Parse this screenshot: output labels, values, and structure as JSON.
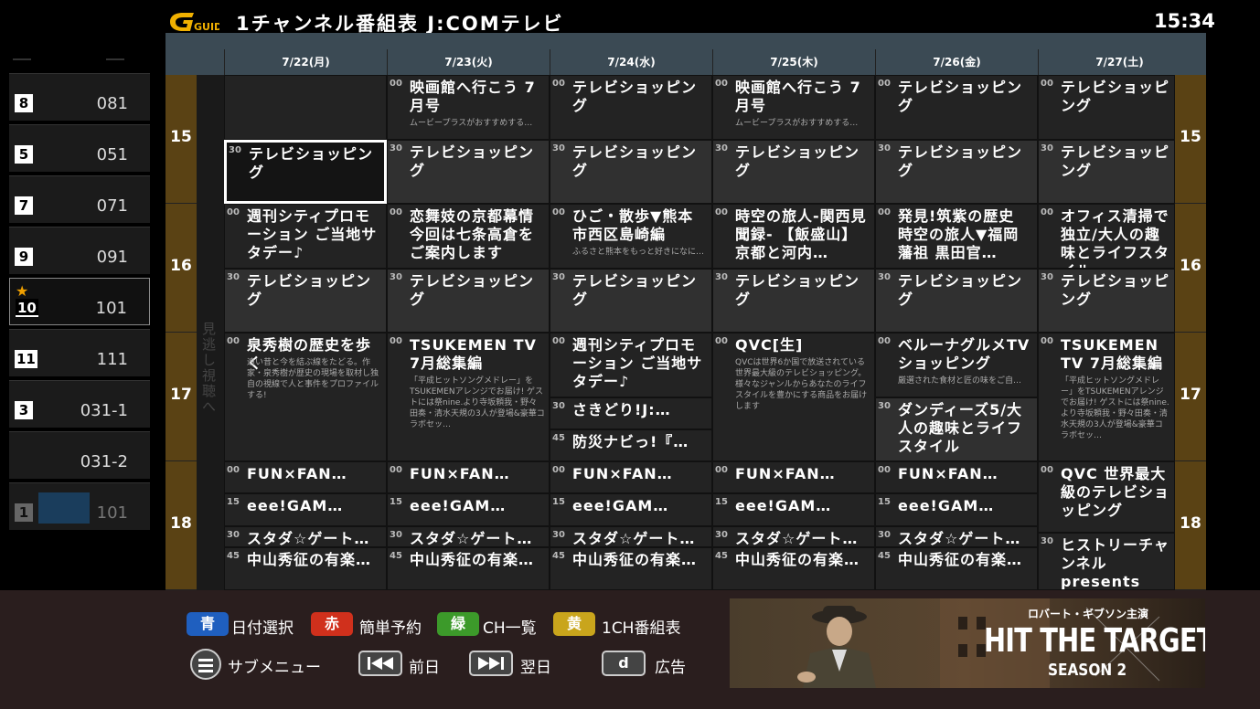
{
  "header": {
    "logo": "GUIDE",
    "title": "1チャンネル番組表 J:COMテレビ",
    "clock": "15:34"
  },
  "channels": [
    {
      "badge": "8",
      "number": "081"
    },
    {
      "badge": "5",
      "number": "051"
    },
    {
      "badge": "7",
      "number": "071"
    },
    {
      "badge": "9",
      "number": "091"
    },
    {
      "badge": "10",
      "number": "101",
      "favorite": true,
      "selected": true
    },
    {
      "badge": "11",
      "number": "111"
    },
    {
      "badge": "3",
      "number": "031-1"
    },
    {
      "badge": "",
      "number": "031-2"
    },
    {
      "badge": "1",
      "number": "101"
    }
  ],
  "dates": [
    "7/22(月)",
    "7/23(火)",
    "7/24(水)",
    "7/25(木)",
    "7/26(金)",
    "7/27(土)"
  ],
  "hours": [
    "15",
    "16",
    "17",
    "18"
  ],
  "missed_label": "見逃し視聴へ",
  "programs": [
    [
      {
        "min": "",
        "title": "",
        "desc": "",
        "start": 0,
        "span": 0.5
      },
      {
        "min": "30",
        "title": "テレビショッピング",
        "desc": "",
        "start": 0.5,
        "span": 0.5,
        "selected": true
      },
      {
        "min": "00",
        "title": "週刊シティプロモーション ご当地サタデー♪",
        "desc": "",
        "start": 1,
        "span": 0.5
      },
      {
        "min": "30",
        "title": "テレビショッピング",
        "desc": "",
        "start": 1.5,
        "span": 0.5
      },
      {
        "min": "00",
        "title": "泉秀樹の歴史を歩く",
        "desc": "遠い昔と今を結ぶ線をたどる。作家・泉秀樹が歴史の現場を取材し独自の視線で人と事件をプロファイルする!",
        "start": 2,
        "span": 1
      },
      {
        "min": "00",
        "title": "FUN×FAN…",
        "desc": "",
        "start": 3,
        "span": 0.25
      },
      {
        "min": "15",
        "title": "eee!GAM…",
        "desc": "",
        "start": 3.25,
        "span": 0.25
      },
      {
        "min": "30",
        "title": "スタダ☆ゲート…",
        "desc": "",
        "start": 3.5,
        "span": 0.17
      },
      {
        "min": "45",
        "title": "中山秀征の有楽…",
        "desc": "",
        "start": 3.67,
        "span": 0.33
      }
    ],
    [
      {
        "min": "00",
        "title": "映画館へ行こう 7月号",
        "desc": "ムービープラスがおすすめする…",
        "start": 0,
        "span": 0.5
      },
      {
        "min": "30",
        "title": "テレビショッピング",
        "desc": "",
        "start": 0.5,
        "span": 0.5
      },
      {
        "min": "00",
        "title": "恋舞妓の京都幕情 今回は七条高倉をご案内します",
        "desc": "",
        "start": 1,
        "span": 0.5
      },
      {
        "min": "30",
        "title": "テレビショッピング",
        "desc": "",
        "start": 1.5,
        "span": 0.5
      },
      {
        "min": "00",
        "title": "TSUKEMEN TV 7月総集編",
        "desc": "「平成ヒットソングメドレー」をTSUKEMENアレンジでお届け! ゲストには祭nine.より寺坂頼我・野々田奏・清水天規の3人が登場&豪華コラボセッ…",
        "start": 2,
        "span": 1
      },
      {
        "min": "00",
        "title": "FUN×FAN…",
        "desc": "",
        "start": 3,
        "span": 0.25
      },
      {
        "min": "15",
        "title": "eee!GAM…",
        "desc": "",
        "start": 3.25,
        "span": 0.25
      },
      {
        "min": "30",
        "title": "スタダ☆ゲート…",
        "desc": "",
        "start": 3.5,
        "span": 0.17
      },
      {
        "min": "45",
        "title": "中山秀征の有楽…",
        "desc": "",
        "start": 3.67,
        "span": 0.33
      }
    ],
    [
      {
        "min": "00",
        "title": "テレビショッピング",
        "desc": "",
        "start": 0,
        "span": 0.5
      },
      {
        "min": "30",
        "title": "テレビショッピング",
        "desc": "",
        "start": 0.5,
        "span": 0.5
      },
      {
        "min": "00",
        "title": "ひご・散歩▼熊本市西区島崎編",
        "desc": "ふるさと熊本をもっと好きになに…",
        "start": 1,
        "span": 0.5
      },
      {
        "min": "30",
        "title": "テレビショッピング",
        "desc": "",
        "start": 1.5,
        "span": 0.5
      },
      {
        "min": "00",
        "title": "週刊シティプロモーション ご当地サタデー♪",
        "desc": "",
        "start": 2,
        "span": 0.5
      },
      {
        "min": "30",
        "title": "さきどり!J:…",
        "desc": "",
        "start": 2.5,
        "span": 0.25
      },
      {
        "min": "45",
        "title": "防災ナビっ!『…",
        "desc": "",
        "start": 2.75,
        "span": 0.25
      },
      {
        "min": "00",
        "title": "FUN×FAN…",
        "desc": "",
        "start": 3,
        "span": 0.25
      },
      {
        "min": "15",
        "title": "eee!GAM…",
        "desc": "",
        "start": 3.25,
        "span": 0.25
      },
      {
        "min": "30",
        "title": "スタダ☆ゲート…",
        "desc": "",
        "start": 3.5,
        "span": 0.17
      },
      {
        "min": "45",
        "title": "中山秀征の有楽…",
        "desc": "",
        "start": 3.67,
        "span": 0.33
      }
    ],
    [
      {
        "min": "00",
        "title": "映画館へ行こう 7月号",
        "desc": "ムービープラスがおすすめする…",
        "start": 0,
        "span": 0.5
      },
      {
        "min": "30",
        "title": "テレビショッピング",
        "desc": "",
        "start": 0.5,
        "span": 0.5
      },
      {
        "min": "00",
        "title": "時空の旅人-関西見聞録- 【飯盛山】京都と河内…",
        "desc": "",
        "start": 1,
        "span": 0.5
      },
      {
        "min": "30",
        "title": "テレビショッピング",
        "desc": "",
        "start": 1.5,
        "span": 0.5
      },
      {
        "min": "00",
        "title": "QVC[生]",
        "desc": "QVCは世界6か国で放送されている世界最大級のテレビショッピング。様々なジャンルからあなたのライフスタイルを豊かにする商品をお届けします",
        "start": 2,
        "span": 1
      },
      {
        "min": "00",
        "title": "FUN×FAN…",
        "desc": "",
        "start": 3,
        "span": 0.25
      },
      {
        "min": "15",
        "title": "eee!GAM…",
        "desc": "",
        "start": 3.25,
        "span": 0.25
      },
      {
        "min": "30",
        "title": "スタダ☆ゲート…",
        "desc": "",
        "start": 3.5,
        "span": 0.17
      },
      {
        "min": "45",
        "title": "中山秀征の有楽…",
        "desc": "",
        "start": 3.67,
        "span": 0.33
      }
    ],
    [
      {
        "min": "00",
        "title": "テレビショッピング",
        "desc": "",
        "start": 0,
        "span": 0.5
      },
      {
        "min": "30",
        "title": "テレビショッピング",
        "desc": "",
        "start": 0.5,
        "span": 0.5
      },
      {
        "min": "00",
        "title": "発見!筑紫の歴史 時空の旅人▼福岡藩祖 黒田官…",
        "desc": "",
        "start": 1,
        "span": 0.5
      },
      {
        "min": "30",
        "title": "テレビショッピング",
        "desc": "",
        "start": 1.5,
        "span": 0.5
      },
      {
        "min": "00",
        "title": "ベルーナグルメTVショッピング",
        "desc": "厳選された食材と匠の味をご自…",
        "start": 2,
        "span": 0.5
      },
      {
        "min": "30",
        "title": "ダンディーズ5/大人の趣味とライフスタイル",
        "desc": "",
        "start": 2.5,
        "span": 0.5
      },
      {
        "min": "00",
        "title": "FUN×FAN…",
        "desc": "",
        "start": 3,
        "span": 0.25
      },
      {
        "min": "15",
        "title": "eee!GAM…",
        "desc": "",
        "start": 3.25,
        "span": 0.25
      },
      {
        "min": "30",
        "title": "スタダ☆ゲート…",
        "desc": "",
        "start": 3.5,
        "span": 0.17
      },
      {
        "min": "45",
        "title": "中山秀征の有楽…",
        "desc": "",
        "start": 3.67,
        "span": 0.33
      }
    ],
    [
      {
        "min": "00",
        "title": "テレビショッピング",
        "desc": "",
        "start": 0,
        "span": 0.5
      },
      {
        "min": "30",
        "title": "テレビショッピング",
        "desc": "",
        "start": 0.5,
        "span": 0.5
      },
      {
        "min": "00",
        "title": "オフィス清掃で独立/大人の趣味とライフスタイル",
        "desc": "",
        "start": 1,
        "span": 0.5
      },
      {
        "min": "30",
        "title": "テレビショッピング",
        "desc": "",
        "start": 1.5,
        "span": 0.5
      },
      {
        "min": "00",
        "title": "TSUKEMEN TV 7月総集編",
        "desc": "「平成ヒットソングメドレー」をTSUKEMENアレンジでお届け! ゲストには祭nine.より寺坂頼我・野々田奏・清水天規の3人が登場&豪華コラボセッ…",
        "start": 2,
        "span": 1
      },
      {
        "min": "00",
        "title": "QVC 世界最大級のテレビショッピング",
        "desc": "",
        "start": 3,
        "span": 0.55
      },
      {
        "min": "30",
        "title": "ヒストリーチャンネルpresents「古代の宇宙…",
        "desc": "",
        "start": 3.55,
        "span": 0.45
      }
    ]
  ],
  "color_keys": [
    {
      "key": "青",
      "label": "日付選択",
      "color": "#1f5fbf"
    },
    {
      "key": "赤",
      "label": "簡単予約",
      "color": "#d0301c"
    },
    {
      "key": "緑",
      "label": "CH一覧",
      "color": "#3c9a2a"
    },
    {
      "key": "黄",
      "label": "1CH番組表",
      "color": "#c9a51c"
    }
  ],
  "nav_keys": {
    "submenu_label": "サブメニュー",
    "prev_label": "前日",
    "next_label": "翌日",
    "d_key": "d",
    "ad_label": "広告"
  },
  "ad": {
    "tag": "ロバート・ギブソン主演",
    "title": "HIT THE TARGET",
    "subtitle": "SEASON 2"
  }
}
